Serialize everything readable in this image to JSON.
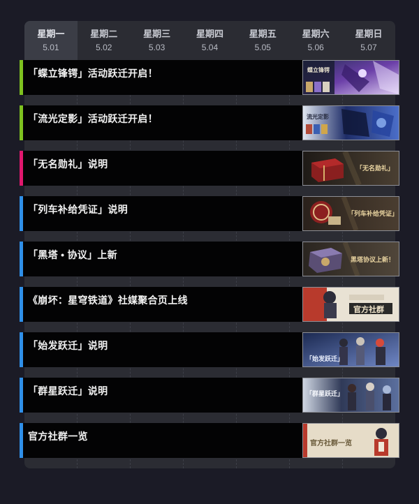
{
  "days": [
    {
      "name": "星期一",
      "date": "5.01"
    },
    {
      "name": "星期二",
      "date": "5.02"
    },
    {
      "name": "星期三",
      "date": "5.03"
    },
    {
      "name": "星期四",
      "date": "5.04"
    },
    {
      "name": "星期五",
      "date": "5.05"
    },
    {
      "name": "星期六",
      "date": "5.06"
    },
    {
      "name": "星期日",
      "date": "5.07"
    }
  ],
  "events": [
    {
      "title": "「蝶立锋锷」活动跃迁开启！",
      "color": "#7ec11f",
      "thumb_caption": "蝶立锋锷"
    },
    {
      "title": "「流光定影」活动跃迁开启！",
      "color": "#7ec11f",
      "thumb_caption": "流光定影"
    },
    {
      "title": "「无名勋礼」说明",
      "color": "#e0176d",
      "thumb_caption": "「无名勋礼」"
    },
    {
      "title": "「列车补给凭证」说明",
      "color": "#2f8fe8",
      "thumb_caption": "「列车补给凭证」"
    },
    {
      "title": "「黑塔 • 协议」上新",
      "color": "#2f8fe8",
      "thumb_caption": "黑塔协议上新！"
    },
    {
      "title": "《崩坏：星穹铁道》社媒聚合页上线",
      "color": "#2f8fe8",
      "thumb_caption": "官方社群"
    },
    {
      "title": "「始发跃迁」说明",
      "color": "#2f8fe8",
      "thumb_caption": "「始发跃迁」"
    },
    {
      "title": "「群星跃迁」说明",
      "color": "#2f8fe8",
      "thumb_caption": "「群星跃迁」"
    },
    {
      "title": "官方社群一览",
      "color": "#2f8fe8",
      "thumb_caption": "官方社群一览"
    }
  ]
}
